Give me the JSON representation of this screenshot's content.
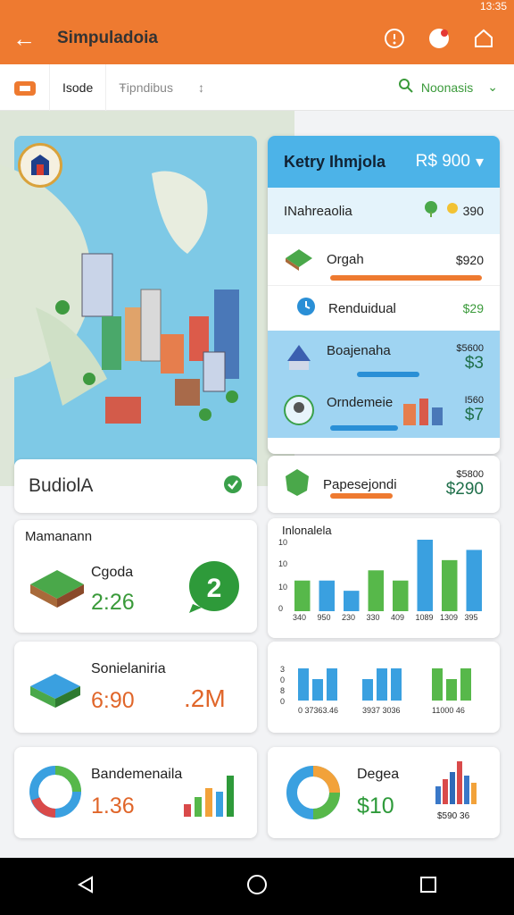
{
  "status": {
    "time": "13:35"
  },
  "appbar": {
    "title": "Simpuladoia"
  },
  "toolbar": {
    "tab_active": "Isode",
    "tab_other": "Ŧipndibus",
    "search_label": "Noonasis"
  },
  "map_card": {
    "label": "BudiolA"
  },
  "panel": {
    "title": "Ketry Ihmjola",
    "amount": "R$ 900",
    "rows": [
      {
        "label": "INahreaolia",
        "value": "390"
      },
      {
        "label": "Orgah",
        "value": "$920"
      },
      {
        "label": "Renduidual",
        "value": "$29"
      },
      {
        "label": "Boajenaha",
        "value_top": "$5600",
        "value": "$3"
      },
      {
        "label": "Orndemeie",
        "value_top": "I560",
        "value": "$7"
      },
      {
        "label": "Papesejondi",
        "value_top": "$5800",
        "value": "$290"
      }
    ]
  },
  "stats": [
    {
      "section": "Mamanann",
      "label": "Cgoda",
      "value": "2:26"
    },
    {
      "label": "Sonielaniria",
      "value": "6:90",
      "extra": ".2M"
    },
    {
      "label": "Bandemenaila",
      "value": "1.36"
    },
    {
      "label": "Degea",
      "value": "$10",
      "subtext": "$590 36"
    }
  ],
  "chart1": {
    "title": "Inlonalela",
    "yticks": [
      "10",
      "10",
      "10",
      "0"
    ]
  },
  "chart2": {
    "ticks": [
      "3",
      "0",
      "8",
      "0"
    ],
    "xlabels": [
      "0 37363.46",
      "3937 3036",
      "11000 46"
    ]
  },
  "colors": {
    "orange": "#ee7a30",
    "blue": "#3aa0e0",
    "green": "#57b84a"
  },
  "chart_data": [
    {
      "type": "bar",
      "title": "Inlonalela",
      "categories": [
        "340",
        "950",
        "230",
        "330",
        "409",
        "1089",
        "1309",
        "395"
      ],
      "series": [
        {
          "values": [
            3,
            0,
            2,
            4,
            3,
            7,
            5,
            3
          ]
        },
        {
          "values": [
            0,
            3,
            0,
            0,
            0,
            0,
            0,
            0
          ]
        },
        {
          "values": [
            0,
            0,
            0,
            0,
            0,
            0,
            0,
            6
          ]
        }
      ]
    },
    {
      "type": "bar",
      "categories": [
        "0 37363.46",
        "3937 3036",
        "11000 46"
      ],
      "series": [
        {
          "values": [
            3,
            2,
            3,
            2,
            3,
            3,
            3,
            2,
            3
          ]
        }
      ]
    }
  ]
}
